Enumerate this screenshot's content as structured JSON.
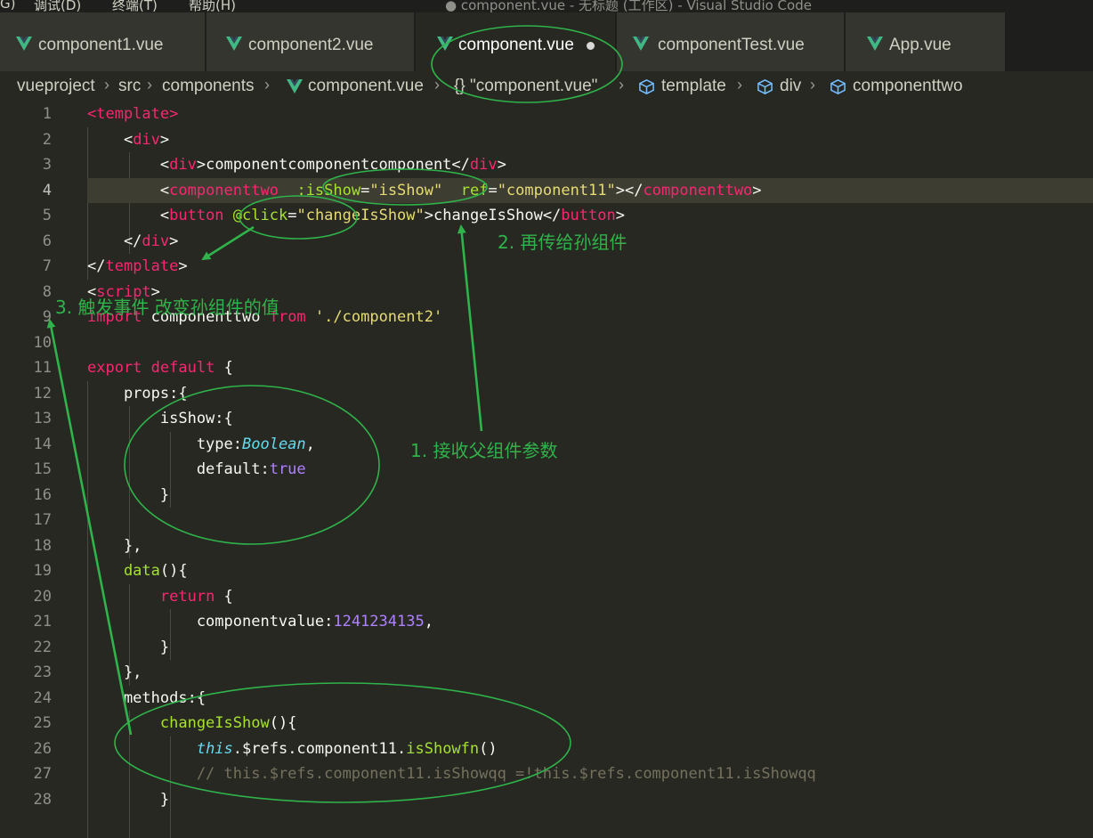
{
  "menubar": {
    "items": [
      "G)",
      "调试(D)",
      "终端(T)",
      "帮助(H)"
    ],
    "title": "● component.vue - 无标题 (工作区) - Visual Studio Code"
  },
  "tabs": [
    {
      "label": "component1.vue"
    },
    {
      "label": "component2.vue"
    },
    {
      "label": "component.vue"
    },
    {
      "label": "componentTest.vue"
    },
    {
      "label": "App.vue"
    }
  ],
  "breadcrumb": {
    "items": [
      "vueproject",
      "src",
      "components",
      "component.vue",
      "{} \"component.vue\"",
      "template",
      "div",
      "componenttwo"
    ]
  },
  "editor": {
    "lines": [
      {
        "n": "1",
        "parts": [
          [
            "t",
            "<template>"
          ]
        ]
      },
      {
        "n": "2",
        "parts": [
          [
            "p",
            "    <"
          ],
          [
            "t",
            "div"
          ],
          [
            "p",
            ">"
          ]
        ]
      },
      {
        "n": "3",
        "parts": [
          [
            "p",
            "        <"
          ],
          [
            "t",
            "div"
          ],
          [
            "p",
            ">componentcomponentcomponent</"
          ],
          [
            "t",
            "div"
          ],
          [
            "p",
            ">"
          ]
        ]
      },
      {
        "n": "4",
        "parts": [
          [
            "p",
            "        <"
          ],
          [
            "t",
            "componenttwo"
          ],
          [
            "p",
            "  "
          ],
          [
            "a",
            ":isShow"
          ],
          [
            "p",
            "="
          ],
          [
            "s",
            "\"isShow\""
          ],
          [
            "p",
            "  "
          ],
          [
            "a",
            "ref"
          ],
          [
            "p",
            "="
          ],
          [
            "s",
            "\"component11\""
          ],
          [
            "p",
            "></"
          ],
          [
            "t",
            "componenttwo"
          ],
          [
            "p",
            ">"
          ]
        ]
      },
      {
        "n": "5",
        "parts": [
          [
            "p",
            "        <"
          ],
          [
            "t",
            "button"
          ],
          [
            "p",
            " "
          ],
          [
            "a",
            "@click"
          ],
          [
            "p",
            "="
          ],
          [
            "s",
            "\"changeIsShow\""
          ],
          [
            "p",
            ">changeIsShow</"
          ],
          [
            "t",
            "button"
          ],
          [
            "p",
            ">"
          ]
        ]
      },
      {
        "n": "6",
        "parts": [
          [
            "p",
            "    </"
          ],
          [
            "t",
            "div"
          ],
          [
            "p",
            ">"
          ]
        ]
      },
      {
        "n": "7",
        "parts": [
          [
            "p",
            "</"
          ],
          [
            "t",
            "template"
          ],
          [
            "p",
            ">"
          ]
        ]
      },
      {
        "n": "8",
        "parts": [
          [
            "p",
            "<"
          ],
          [
            "t",
            "script"
          ],
          [
            "p",
            ">"
          ]
        ]
      },
      {
        "n": "9",
        "parts": [
          [
            "k",
            "import"
          ],
          [
            "p",
            " componenttwo "
          ],
          [
            "k",
            "from"
          ],
          [
            "p",
            " "
          ],
          [
            "s",
            "'./component2'"
          ]
        ]
      },
      {
        "n": "10",
        "parts": []
      },
      {
        "n": "11",
        "parts": [
          [
            "k",
            "export"
          ],
          [
            "p",
            " "
          ],
          [
            "k",
            "default"
          ],
          [
            "p",
            " {"
          ]
        ]
      },
      {
        "n": "12",
        "parts": [
          [
            "p",
            "    props:{"
          ]
        ]
      },
      {
        "n": "13",
        "parts": [
          [
            "p",
            "        isShow:{"
          ]
        ]
      },
      {
        "n": "14",
        "parts": [
          [
            "p",
            "            type:"
          ],
          [
            "ty",
            "Boolean"
          ],
          [
            "p",
            ","
          ]
        ]
      },
      {
        "n": "15",
        "parts": [
          [
            "p",
            "            default:"
          ],
          [
            "n",
            "true"
          ]
        ]
      },
      {
        "n": "16",
        "parts": [
          [
            "p",
            "        }"
          ]
        ]
      },
      {
        "n": "17",
        "parts": []
      },
      {
        "n": "18",
        "parts": [
          [
            "p",
            "    },"
          ]
        ]
      },
      {
        "n": "19",
        "parts": [
          [
            "f",
            "    data"
          ],
          [
            "p",
            "(){"
          ]
        ]
      },
      {
        "n": "20",
        "parts": [
          [
            "p",
            "        "
          ],
          [
            "k",
            "return"
          ],
          [
            "p",
            " {"
          ]
        ]
      },
      {
        "n": "21",
        "parts": [
          [
            "p",
            "            componentvalue:"
          ],
          [
            "n",
            "1241234135"
          ],
          [
            "p",
            ","
          ]
        ]
      },
      {
        "n": "22",
        "parts": [
          [
            "p",
            "        }"
          ]
        ]
      },
      {
        "n": "23",
        "parts": [
          [
            "p",
            "    },"
          ]
        ]
      },
      {
        "n": "24",
        "parts": [
          [
            "p",
            "    methods:{"
          ]
        ]
      },
      {
        "n": "25",
        "parts": [
          [
            "f",
            "        changeIsShow"
          ],
          [
            "p",
            "(){"
          ]
        ]
      },
      {
        "n": "26",
        "parts": [
          [
            "p",
            "            "
          ],
          [
            "kt",
            "this"
          ],
          [
            "p",
            ".$refs.component11."
          ],
          [
            "f",
            "isShowfn"
          ],
          [
            "p",
            "()"
          ]
        ]
      },
      {
        "n": "27",
        "parts": [
          [
            "c",
            "            // this.$refs.component11.isShowqq =!this.$refs.component11.isShowqq"
          ]
        ]
      },
      {
        "n": "28",
        "parts": [
          [
            "p",
            "        }"
          ]
        ]
      }
    ]
  },
  "annotations": {
    "note1": "1.  接收父组件参数",
    "note2": "2.  再传给孙组件",
    "note3": "3.  触发事件 改变孙组件的值"
  },
  "colors": {
    "annotation": "#2fb34a",
    "editor_bg": "#272822",
    "tab_bg": "#34352f",
    "vue_icon": "#41b883"
  }
}
